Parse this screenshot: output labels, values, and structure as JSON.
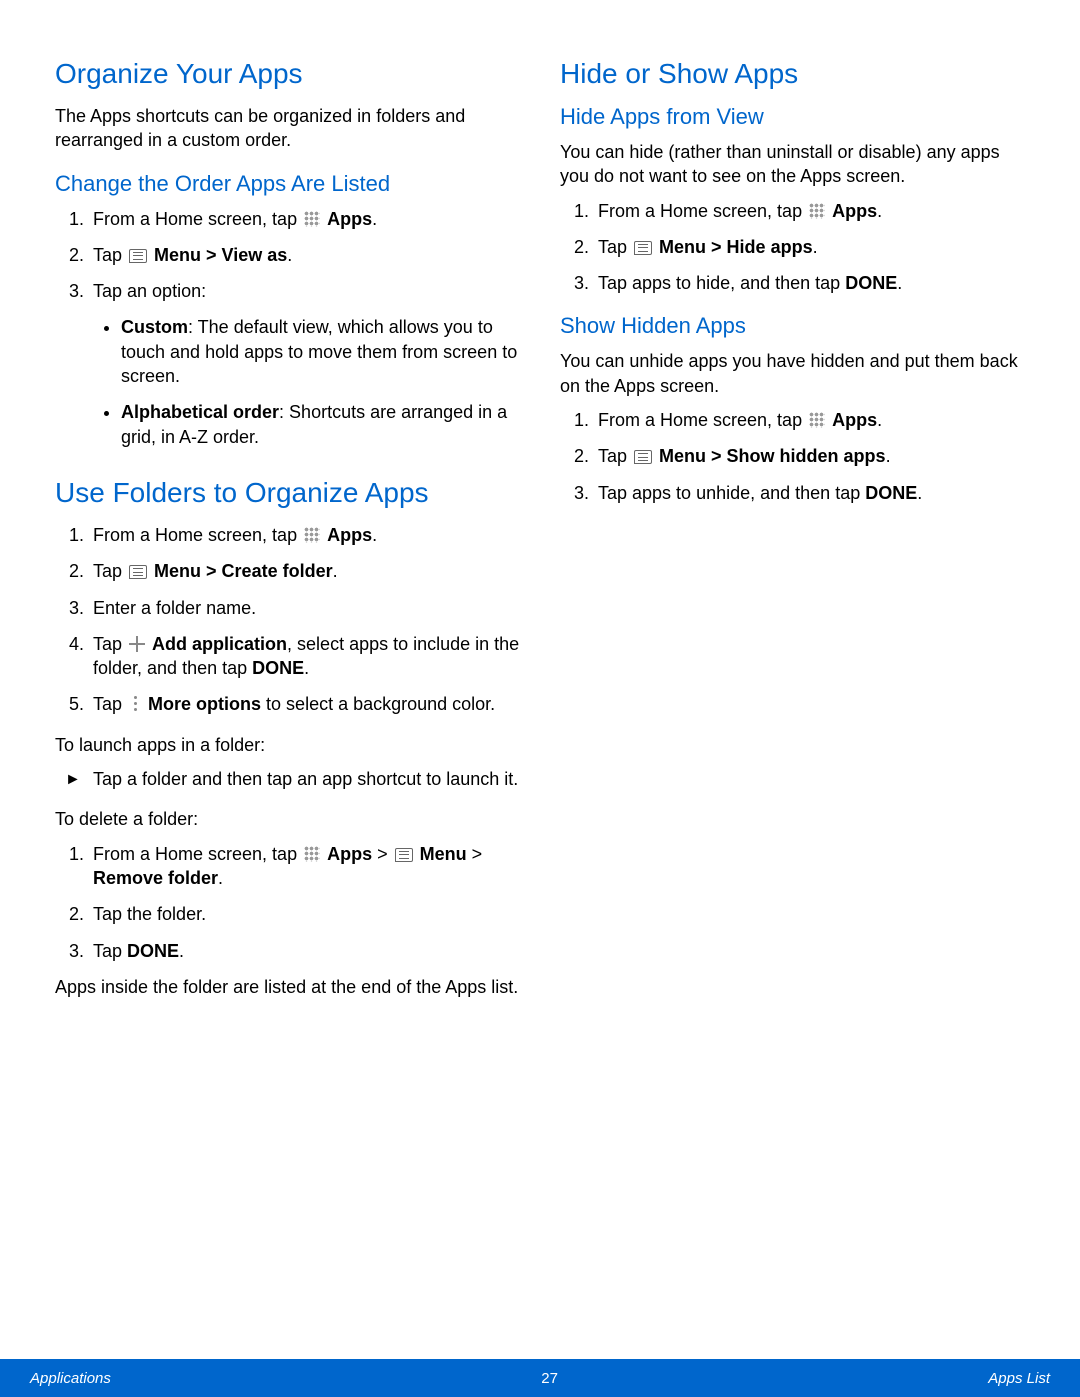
{
  "left": {
    "h1_organize": "Organize Your Apps",
    "organize_intro": "The Apps shortcuts can be organized in folders and rearranged in a custom order.",
    "h2_change_order": "Change the Order Apps Are Listed",
    "change_steps": {
      "s1_pre": "From a Home screen, tap ",
      "s1_post": "Apps",
      "s2_pre": "Tap ",
      "s2_post": "Menu > View as",
      "s3": "Tap an option:",
      "opt_custom_label": "Custom",
      "opt_custom_text": ": The default view, which allows you to touch and hold apps to move them from screen to screen.",
      "opt_alpha_label": "Alphabetical order",
      "opt_alpha_text": ": Shortcuts are arranged in a grid, in A-Z order."
    },
    "h1_folders": "Use Folders to Organize Apps",
    "folder_steps": {
      "s1_pre": "From a Home screen, tap ",
      "s1_post": "Apps",
      "s2_pre": "Tap ",
      "s2_post": "Menu > Create folder",
      "s3": "Enter a folder name.",
      "s4_pre": "Tap ",
      "s4_mid": "Add application",
      "s4_post": ", select apps to include in the folder, and then tap ",
      "s4_done": "DONE",
      "s5_pre": "Tap ",
      "s5_mid": "More options",
      "s5_post": " to select a background color."
    },
    "launch_intro": "To launch apps in a folder:",
    "launch_step": "Tap a folder and then tap an app shortcut to launch it.",
    "delete_intro": "To delete a folder:",
    "delete_steps": {
      "s1_pre": "From a Home screen, tap ",
      "s1_apps": "Apps",
      "s1_gt1": " > ",
      "s1_menu": "Menu",
      "s1_gt2": " > ",
      "s1_remove": "Remove folder",
      "s2": "Tap the folder.",
      "s3_pre": "Tap ",
      "s3_done": "DONE"
    },
    "delete_note": "Apps inside the folder are listed at the end of the Apps list."
  },
  "right": {
    "h1_hide": "Hide or Show Apps",
    "h2_hide_view": "Hide Apps from View",
    "hide_intro": "You can hide (rather than uninstall or disable) any apps you do not want to see on the Apps screen.",
    "hide_steps": {
      "s1_pre": "From a Home screen, tap ",
      "s1_post": "Apps",
      "s2_pre": "Tap ",
      "s2_post": "Menu > Hide apps",
      "s3_pre": "Tap apps to hide, and then tap ",
      "s3_done": "DONE"
    },
    "h2_show": "Show Hidden Apps",
    "show_intro": "You can unhide apps you have hidden and put them back on the Apps screen.",
    "show_steps": {
      "s1_pre": "From a Home screen, tap ",
      "s1_post": "Apps",
      "s2_pre": "Tap ",
      "s2_post": "Menu > Show hidden apps",
      "s3_pre": "Tap apps to unhide, and then tap ",
      "s3_done": "DONE"
    }
  },
  "footer": {
    "left": "Applications",
    "center": "27",
    "right": "Apps List"
  },
  "period": "."
}
